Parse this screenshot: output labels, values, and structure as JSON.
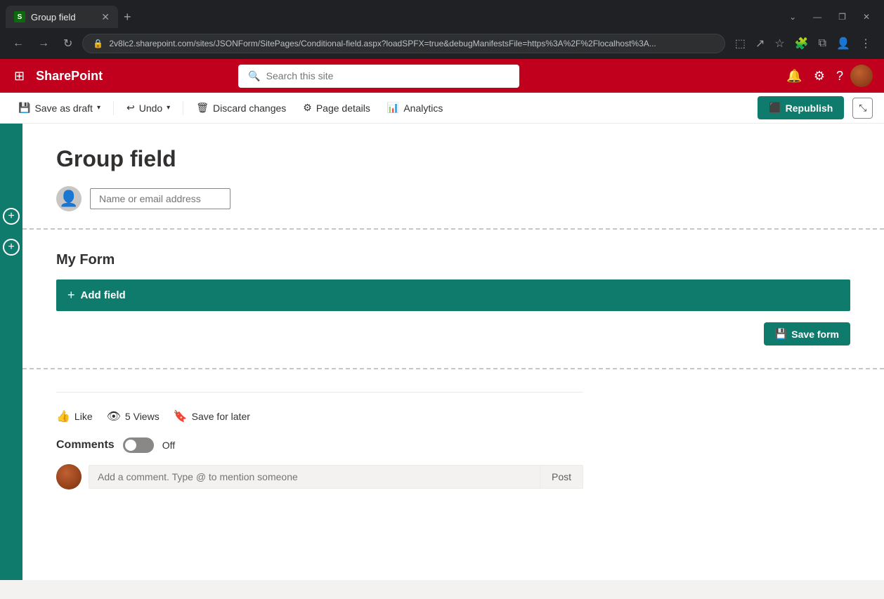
{
  "browser": {
    "tab_title": "Group field",
    "tab_favicon": "S",
    "url": "2v8lc2.sharepoint.com/sites/JSONForm/SitePages/Conditional-field.aspx?loadSPFX=true&debugManifestsFile=https%3A%2F%2Flocalhost%3A...",
    "new_tab_label": "+",
    "window_controls": {
      "minimize": "—",
      "maximize": "❐",
      "close": "✕",
      "chevron": "⌄"
    }
  },
  "sharepoint_header": {
    "app_name": "SharePoint",
    "search_placeholder": "Search this site",
    "waffle_icon": "⊞"
  },
  "toolbar": {
    "save_as_draft_label": "Save as draft",
    "undo_label": "Undo",
    "discard_changes_label": "Discard changes",
    "page_details_label": "Page details",
    "analytics_label": "Analytics",
    "republish_label": "Republish"
  },
  "page": {
    "title": "Group field",
    "people_picker_placeholder": "Name or email address"
  },
  "form": {
    "title": "My Form",
    "add_field_label": "Add field",
    "save_form_label": "Save form"
  },
  "footer": {
    "like_label": "Like",
    "views_count": "5",
    "views_label": "Views",
    "save_for_later_label": "Save for later",
    "comments_label": "Comments",
    "toggle_status": "Off",
    "comment_placeholder": "Add a comment. Type @ to mention someone",
    "post_label": "Post"
  },
  "sidebar": {
    "add_label": "+"
  }
}
